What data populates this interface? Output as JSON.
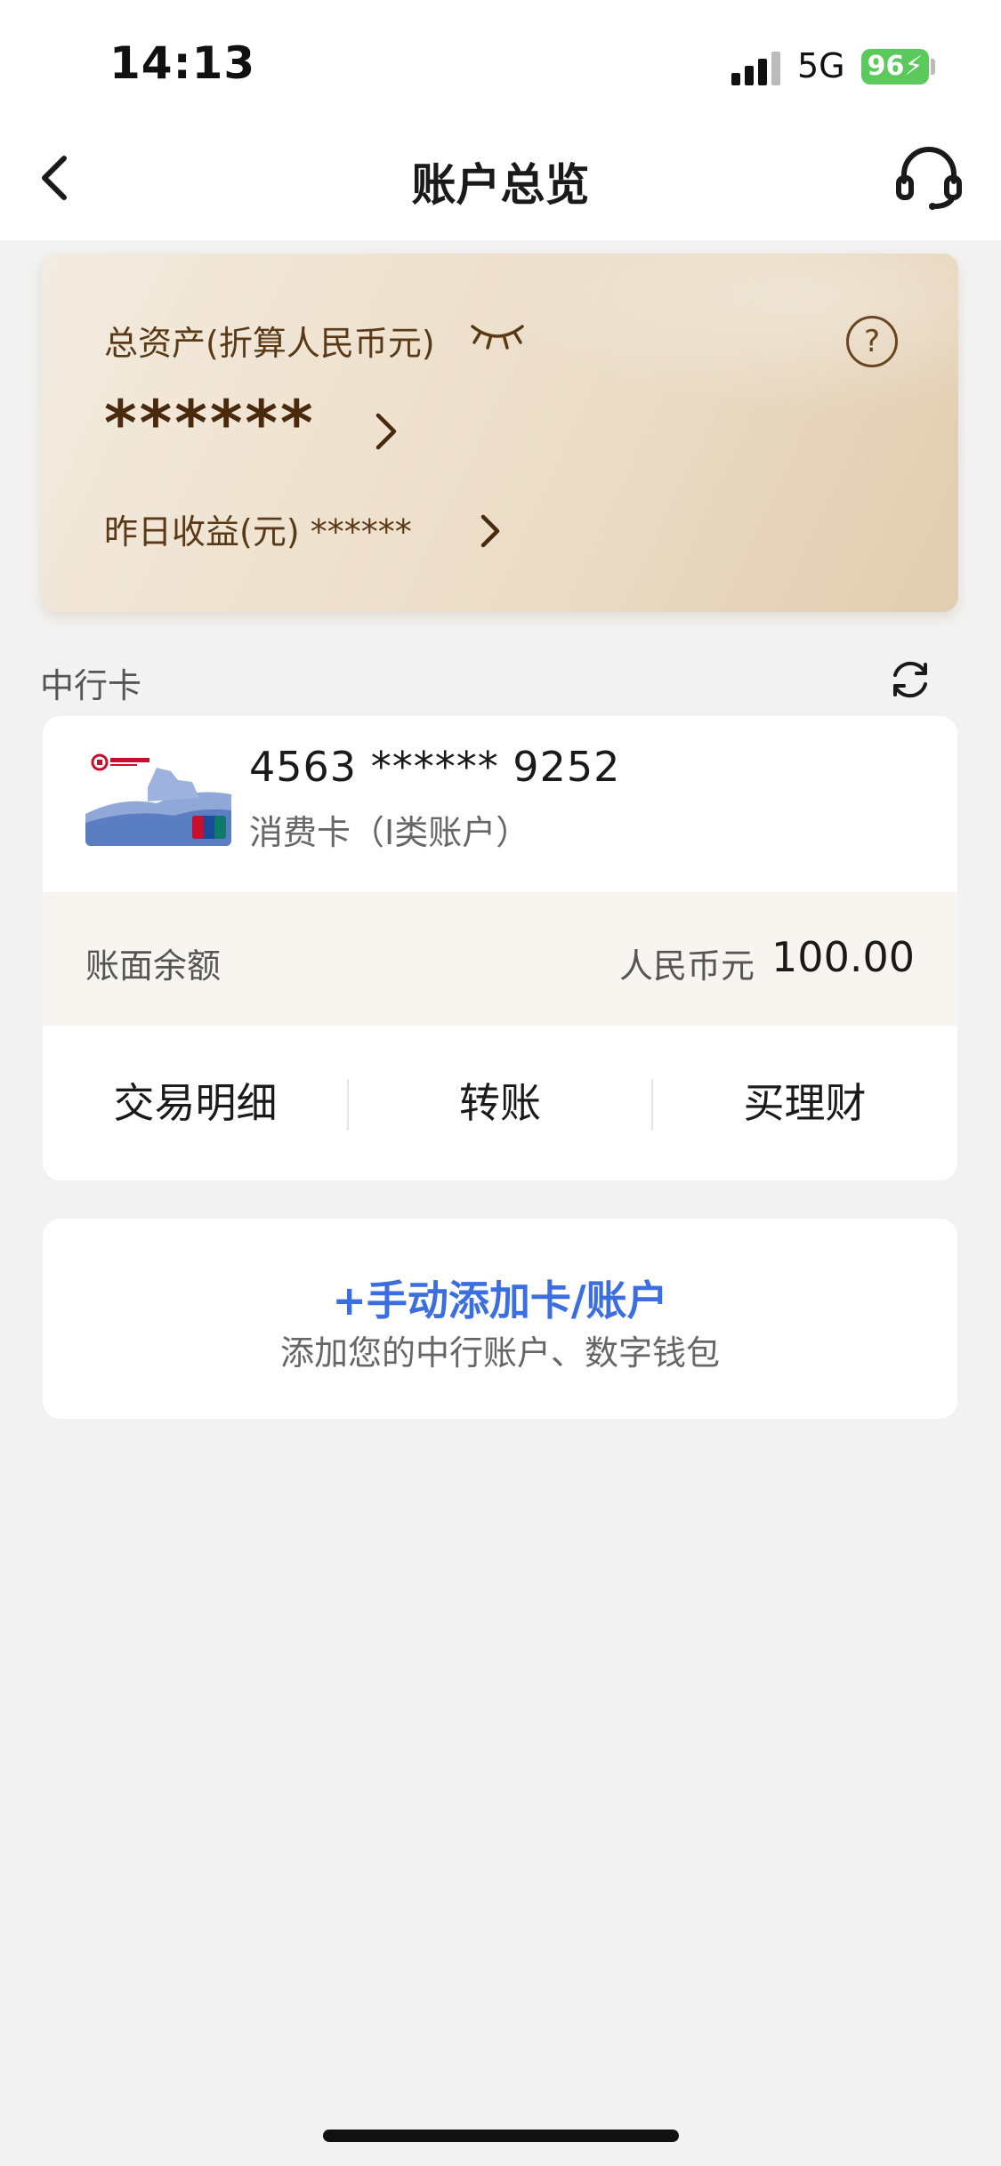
{
  "status_bar": {
    "time": "14:13",
    "network": "5G",
    "battery_text": "96",
    "battery_color": "#5cc95c"
  },
  "nav": {
    "title": "账户总览",
    "back_icon": "chevron-left-icon",
    "service_icon": "headset-icon"
  },
  "assets": {
    "label": "总资产(折算人民币元)",
    "value": "******",
    "yesterday_label": "昨日收益(元) ******",
    "help_glyph": "?"
  },
  "section": {
    "title": "中行卡",
    "refresh_icon": "refresh-icon"
  },
  "card": {
    "number": "4563 ****** 9252",
    "type": "消费卡（I类账户）",
    "balance_label": "账面余额",
    "currency": "人民币元",
    "amount": "100.00",
    "actions": [
      "交易明细",
      "转账",
      "买理财"
    ]
  },
  "add_card": {
    "title": "+手动添加卡/账户",
    "subtitle": "添加您的中行账户、数字钱包",
    "accent_color": "#3b6ee0"
  }
}
